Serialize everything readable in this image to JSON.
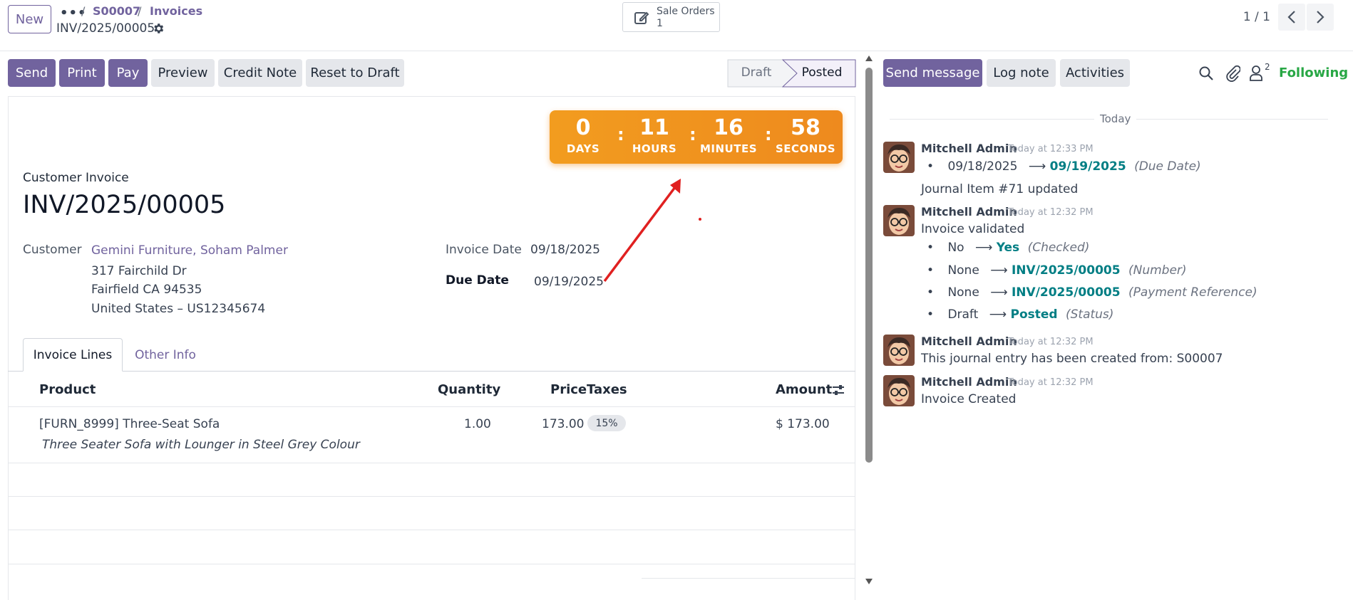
{
  "control_panel": {
    "new_label": "New",
    "more_label": "•••",
    "breadcrumb": [
      {
        "label": "S00007"
      },
      {
        "label": "Invoices"
      }
    ],
    "breadcrumb_sep": "/",
    "record_name": "INV/2025/00005",
    "smart_button": {
      "label": "Sale Orders",
      "count": "1"
    },
    "pager": "1 / 1"
  },
  "actions": {
    "send": "Send",
    "print": "Print",
    "pay": "Pay",
    "preview": "Preview",
    "credit_note": "Credit Note",
    "reset_to_draft": "Reset to Draft"
  },
  "status": {
    "steps": [
      "Draft",
      "Posted"
    ],
    "current": "Posted"
  },
  "countdown": {
    "days": "0",
    "days_label": "DAYS",
    "hours": "11",
    "hours_label": "HOURS",
    "minutes": "16",
    "minutes_label": "MINUTES",
    "seconds": "58",
    "seconds_label": "SECONDS"
  },
  "invoice": {
    "type_label": "Customer Invoice",
    "number": "INV/2025/00005",
    "customer_label": "Customer",
    "customer_name": "Gemini Furniture, Soham Palmer",
    "address_line1": "317 Fairchild Dr",
    "address_line2": "Fairfield CA 94535",
    "address_line3": "United States – US12345674",
    "invoice_date_label": "Invoice Date",
    "invoice_date": "09/18/2025",
    "due_date_label": "Due Date",
    "due_date": "09/19/2025"
  },
  "tabs": [
    {
      "label": "Invoice Lines"
    },
    {
      "label": "Other Info"
    }
  ],
  "table": {
    "headers": {
      "product": "Product",
      "quantity": "Quantity",
      "price": "Price",
      "taxes": "Taxes",
      "amount": "Amount"
    },
    "rows": [
      {
        "product": "[FURN_8999] Three-Seat Sofa",
        "description": "Three Seater Sofa with Lounger in Steel Grey Colour",
        "quantity": "1.00",
        "price": "173.00",
        "tax": "15%",
        "amount": "$ 173.00"
      }
    ]
  },
  "chatter": {
    "send_message": "Send message",
    "log_note": "Log note",
    "activities": "Activities",
    "followers_count": "2",
    "following": "Following",
    "date_separator": "Today",
    "messages": [
      {
        "author": "Mitchell Admin",
        "time": "Today at 12:33 PM",
        "changes": [
          {
            "old": "09/18/2025",
            "new": "09/19/2025",
            "field": "(Due Date)"
          }
        ],
        "body": "Journal Item #71 updated"
      },
      {
        "author": "Mitchell Admin",
        "time": "Today at 12:32 PM",
        "body": "Invoice validated",
        "changes": [
          {
            "old": "No",
            "new": "Yes",
            "field": "(Checked)"
          },
          {
            "old": "None",
            "new": "INV/2025/00005",
            "field": "(Number)"
          },
          {
            "old": "None",
            "new": "INV/2025/00005",
            "field": "(Payment Reference)"
          },
          {
            "old": "Draft",
            "new": "Posted",
            "field": "(Status)"
          }
        ]
      },
      {
        "author": "Mitchell Admin",
        "time": "Today at 12:32 PM",
        "body": "This journal entry has been created from: S00007"
      },
      {
        "author": "Mitchell Admin",
        "time": "Today at 12:32 PM",
        "body": "Invoice Created"
      }
    ]
  },
  "colors": {
    "brand": "#71639e",
    "timer": "#f29c1f",
    "link_teal": "#017e84",
    "following": "#28a745",
    "annotation_arrow": "#e02020"
  },
  "icons": [
    "gear-icon",
    "edit-icon",
    "chevron-left-icon",
    "chevron-right-icon",
    "search-icon",
    "paperclip-icon",
    "user-icon",
    "adjust-icon"
  ]
}
